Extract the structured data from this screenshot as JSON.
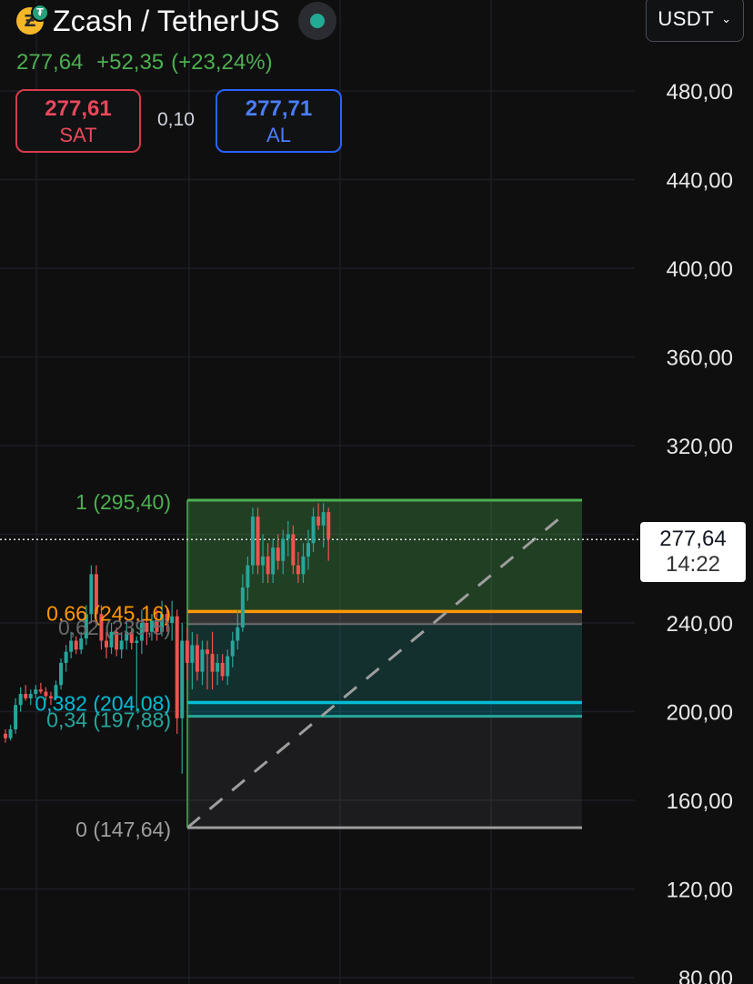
{
  "header": {
    "title": "Zcash / TetherUS",
    "currency": "USDT",
    "price": "277,64",
    "change": "+52,35",
    "change_pct": "(+23,24%)"
  },
  "orders": {
    "sell_price": "277,61",
    "sell_label": "SAT",
    "spread": "0,10",
    "buy_price": "277,71",
    "buy_label": "AL"
  },
  "current": {
    "price_label": "277,64",
    "countdown": "14:22",
    "value": 277.64
  },
  "colors": {
    "up": "#26a69a",
    "down": "#ef5350",
    "fib_top": "#4caf50",
    "fib_066": "#ff9800",
    "fib_0382": "#00bcd4",
    "fib_034": "#26a69a",
    "fib_zero": "#9e9e9e"
  },
  "chart_data": {
    "type": "candlestick",
    "ylim": [
      80,
      500
    ],
    "y_ticks": [
      "480,00",
      "440,00",
      "400,00",
      "360,00",
      "320,00",
      "240,00",
      "200,00",
      "160,00",
      "120,00",
      "80,00"
    ],
    "y_tick_values": [
      480,
      440,
      400,
      360,
      320,
      240,
      200,
      160,
      120,
      80
    ],
    "fib_levels": [
      {
        "label": "1 (295,40)",
        "value": 295.4
      },
      {
        "label": "0,66 (245,16)",
        "value": 245.16
      },
      {
        "label": "0,62 (239,5)",
        "value": 239.5
      },
      {
        "label": "0,382 (204,08)",
        "value": 204.08
      },
      {
        "label": "0,34 (197,88)",
        "value": 197.88
      },
      {
        "label": "0 (147,64)",
        "value": 147.64
      }
    ],
    "candles": [
      [
        190,
        192,
        186,
        188
      ],
      [
        188,
        194,
        187,
        192
      ],
      [
        192,
        206,
        190,
        203
      ],
      [
        203,
        211,
        200,
        208
      ],
      [
        208,
        212,
        205,
        206
      ],
      [
        206,
        210,
        203,
        208
      ],
      [
        208,
        212,
        206,
        210
      ],
      [
        210,
        213,
        208,
        209
      ],
      [
        209,
        211,
        205,
        207
      ],
      [
        207,
        209,
        203,
        206
      ],
      [
        206,
        214,
        205,
        212
      ],
      [
        212,
        224,
        210,
        222
      ],
      [
        222,
        230,
        218,
        227
      ],
      [
        227,
        236,
        224,
        232
      ],
      [
        232,
        234,
        226,
        228
      ],
      [
        228,
        236,
        226,
        233
      ],
      [
        233,
        248,
        230,
        244
      ],
      [
        244,
        266,
        240,
        262
      ],
      [
        262,
        266,
        240,
        244
      ],
      [
        244,
        248,
        228,
        232
      ],
      [
        232,
        236,
        224,
        229
      ],
      [
        229,
        240,
        226,
        236
      ],
      [
        236,
        238,
        225,
        228
      ],
      [
        228,
        236,
        224,
        232
      ],
      [
        232,
        240,
        228,
        236
      ],
      [
        236,
        238,
        228,
        231
      ],
      [
        231,
        234,
        200,
        232
      ],
      [
        232,
        246,
        226,
        240
      ],
      [
        240,
        248,
        230,
        236
      ],
      [
        236,
        244,
        232,
        241
      ],
      [
        241,
        246,
        232,
        236
      ],
      [
        236,
        250,
        234,
        244
      ],
      [
        244,
        246,
        236,
        240
      ],
      [
        240,
        250,
        232,
        243
      ],
      [
        243,
        246,
        190,
        197
      ],
      [
        197,
        240,
        172,
        232
      ],
      [
        232,
        238,
        214,
        222
      ],
      [
        222,
        236,
        210,
        230
      ],
      [
        230,
        235,
        214,
        218
      ],
      [
        218,
        232,
        212,
        228
      ],
      [
        228,
        232,
        210,
        226
      ],
      [
        226,
        236,
        210,
        218
      ],
      [
        218,
        226,
        212,
        222
      ],
      [
        222,
        226,
        214,
        216
      ],
      [
        216,
        228,
        212,
        225
      ],
      [
        225,
        236,
        220,
        232
      ],
      [
        232,
        246,
        228,
        238
      ],
      [
        238,
        262,
        236,
        256
      ],
      [
        256,
        270,
        250,
        266
      ],
      [
        266,
        292,
        262,
        288
      ],
      [
        288,
        292,
        262,
        266
      ],
      [
        266,
        280,
        258,
        270
      ],
      [
        270,
        276,
        258,
        262
      ],
      [
        262,
        278,
        258,
        274
      ],
      [
        274,
        280,
        264,
        268
      ],
      [
        268,
        282,
        262,
        278
      ],
      [
        278,
        286,
        270,
        280
      ],
      [
        280,
        284,
        262,
        266
      ],
      [
        266,
        272,
        258,
        262
      ],
      [
        262,
        276,
        258,
        270
      ],
      [
        270,
        282,
        264,
        276
      ],
      [
        276,
        292,
        272,
        288
      ],
      [
        288,
        294,
        282,
        284
      ],
      [
        284,
        294,
        274,
        290
      ],
      [
        290,
        292,
        268,
        278
      ]
    ]
  }
}
